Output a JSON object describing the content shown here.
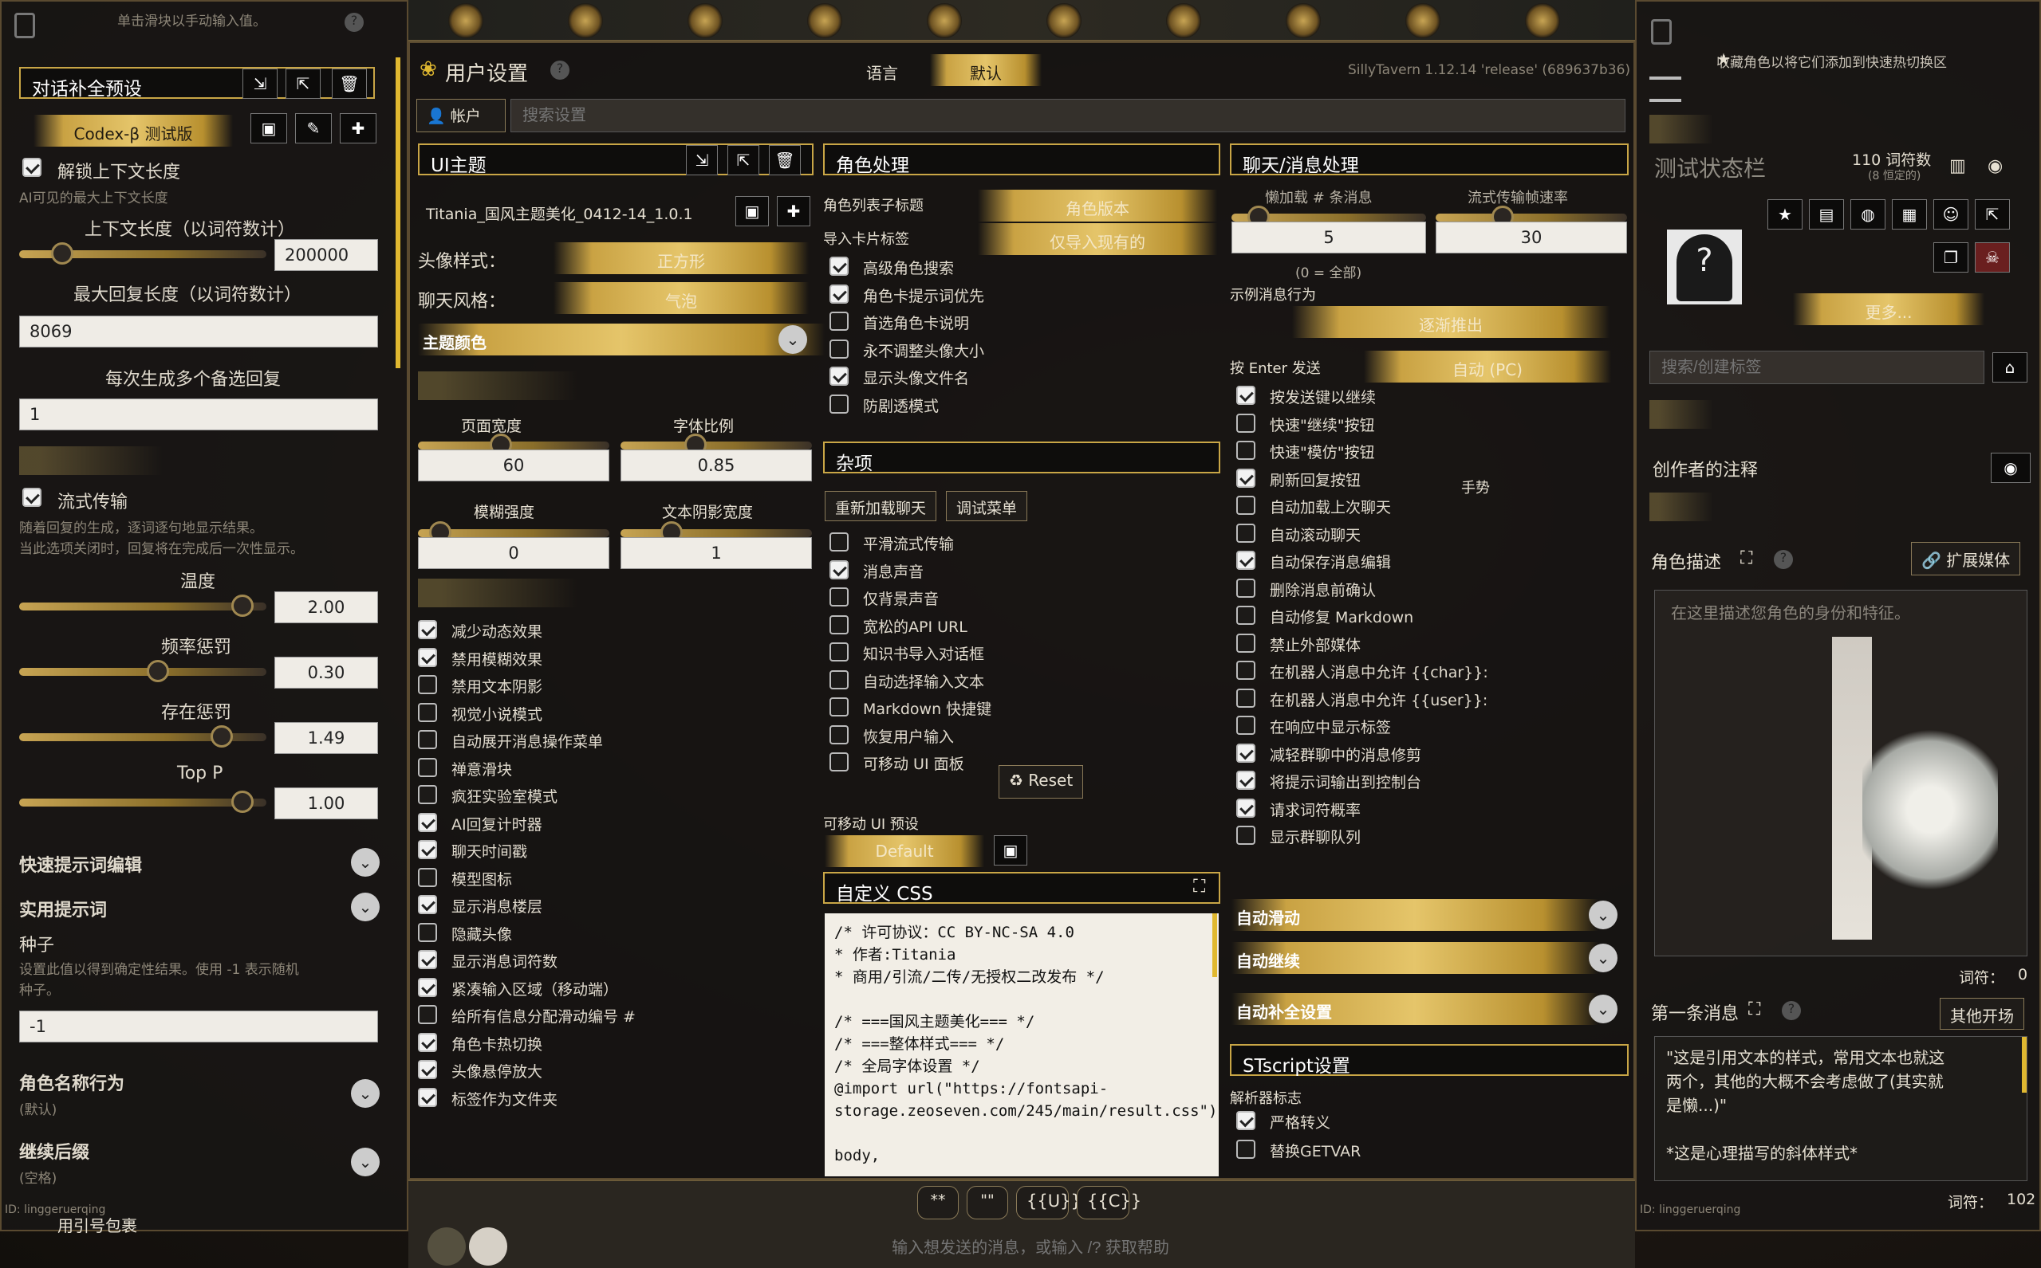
{
  "left": {
    "hint": "单击滑块以手动输入值。",
    "preset_header": "对话补全预设",
    "preset_name": "Codex-β 测试版",
    "unlock_ctx": "解锁上下文长度",
    "unlock_desc": "AI可见的最大上下文长度",
    "ctx_label": "上下文长度（以词符数计）",
    "ctx_value": "200000",
    "resp_label": "最大回复长度（以词符数计）",
    "resp_value": "8069",
    "n_label": "每次生成多个备选回复",
    "n_value": "1",
    "stream_label": "流式传输",
    "stream_desc1": "随着回复的生成，逐词逐句地显示结果。",
    "stream_desc2": "当此选项关闭时，回复将在完成后一次性显示。",
    "temp_label": "温度",
    "temp_value": "2.00",
    "freq_label": "频率惩罚",
    "freq_value": "0.30",
    "pres_label": "存在惩罚",
    "pres_value": "1.49",
    "topp_label": "Top P",
    "topp_value": "1.00",
    "quick_edit": "快速提示词编辑",
    "utility": "实用提示词",
    "seed_label": "种子",
    "seed_desc1": "设置此值以得到确定性结果。使用 -1 表示随机",
    "seed_desc2": "种子。",
    "seed_value": "-1",
    "name_behavior": "角色名称行为",
    "name_default": "(默认)",
    "continue_postfix": "继续后缀",
    "continue_value": "(空格)",
    "id_text": "ID: linggeruerqing",
    "cut_text": "用引号包裹"
  },
  "center": {
    "title": "用户设置",
    "lang_label": "语言",
    "lang_value": "默认",
    "version": "SillyTavern 1.12.14 'release' (689637b36)",
    "account": "帐户",
    "search_placeholder": "搜索设置",
    "ui_theme": "UI主题",
    "theme_name": "Titania_国风主题美化_0412-14_1.0.1",
    "avatar_style_label": "头像样式：",
    "avatar_style_value": "正方形",
    "chat_style_label": "聊天风格：",
    "chat_style_value": "气泡",
    "theme_color": "主题颜色",
    "page_width": "页面宽度",
    "font_scale": "字体比例",
    "page_width_value": "60",
    "font_scale_value": "0.85",
    "blur": "模糊强度",
    "shadow": "文本阴影宽度",
    "blur_value": "0",
    "shadow_value": "1",
    "ui_checks": [
      {
        "label": "减少动态效果",
        "on": true
      },
      {
        "label": "禁用模糊效果",
        "on": true
      },
      {
        "label": "禁用文本阴影",
        "on": false
      },
      {
        "label": "视觉小说模式",
        "on": false
      },
      {
        "label": "自动展开消息操作菜单",
        "on": false
      },
      {
        "label": "禅意滑块",
        "on": false
      },
      {
        "label": "疯狂实验室模式",
        "on": false
      },
      {
        "label": "AI回复计时器",
        "on": true
      },
      {
        "label": "聊天时间戳",
        "on": true
      },
      {
        "label": "模型图标",
        "on": false
      },
      {
        "label": "显示消息楼层",
        "on": true
      },
      {
        "label": "隐藏头像",
        "on": false
      },
      {
        "label": "显示消息词符数",
        "on": true
      },
      {
        "label": "紧凑输入区域（移动端）",
        "on": true
      },
      {
        "label": "给所有信息分配滑动编号 #",
        "on": false
      },
      {
        "label": "角色卡热切换",
        "on": true
      },
      {
        "label": "头像悬停放大",
        "on": true
      },
      {
        "label": "标签作为文件夹",
        "on": true
      }
    ],
    "char_header": "角色处理",
    "char_list_label": "角色列表子标题",
    "char_list_value": "角色版本",
    "import_tags_label": "导入卡片标签",
    "import_tags_value": "仅导入现有的",
    "char_checks": [
      {
        "label": "高级角色搜索",
        "on": true
      },
      {
        "label": "角色卡提示词优先",
        "on": true
      },
      {
        "label": "首选角色卡说明",
        "on": false
      },
      {
        "label": "永不调整头像大小",
        "on": false
      },
      {
        "label": "显示头像文件名",
        "on": true
      },
      {
        "label": "防剧透模式",
        "on": false
      }
    ],
    "misc_header": "杂项",
    "reload_chat": "重新加载聊天",
    "debug_menu": "调试菜单",
    "misc_checks": [
      {
        "label": "平滑流式传输",
        "on": false
      },
      {
        "label": "消息声音",
        "on": true
      },
      {
        "label": "仅背景声音",
        "on": false
      },
      {
        "label": "宽松的API URL",
        "on": false
      },
      {
        "label": "知识书导入对话框",
        "on": false
      },
      {
        "label": "自动选择输入文本",
        "on": false
      },
      {
        "label": "Markdown 快捷键",
        "on": false
      },
      {
        "label": "恢复用户输入",
        "on": false
      },
      {
        "label": "可移动 UI 面板",
        "on": false
      }
    ],
    "reset": "Reset",
    "movable_preset": "可移动 UI 预设",
    "movable_value": "Default",
    "custom_css": "自定义 CSS",
    "css_text": "/* 许可协议：CC BY-NC-SA 4.0\n* 作者:Titania\n* 商用/引流/二传/无授权二改发布 */\n\n/* ===国风主题美化=== */\n/* ===整体样式=== */\n/* 全局字体设置 */\n@import url(\"https://fontsapi-\nstorage.zeoseven.com/245/main/result.css\");\n\nbody,",
    "chat_header": "聊天/消息处理",
    "lazy_label": "懒加载 # 条消息",
    "stream_fps": "流式传输帧速率",
    "lazy_value": "5",
    "fps_value": "30",
    "zero_all": "(0 = 全部)",
    "example_label": "示例消息行为",
    "example_value": "逐渐推出",
    "enter_label": "按 Enter 发送",
    "enter_value": "自动 (PC)",
    "chat_checks": [
      {
        "label": "按发送键以继续",
        "on": true
      },
      {
        "label": "快速\"继续\"按钮",
        "on": false
      },
      {
        "label": "快速\"模仿\"按钮",
        "on": false
      },
      {
        "label": "刷新回复按钮",
        "on": true
      },
      {
        "label": "自动加载上次聊天",
        "on": false
      },
      {
        "label": "自动滚动聊天",
        "on": false
      },
      {
        "label": "自动保存消息编辑",
        "on": true
      },
      {
        "label": "删除消息前确认",
        "on": false
      },
      {
        "label": "自动修复 Markdown",
        "on": false
      },
      {
        "label": "禁止外部媒体",
        "on": false
      },
      {
        "label": "在机器人消息中允许 {{char}}:",
        "on": false
      },
      {
        "label": "在机器人消息中允许 {{user}}:",
        "on": false
      },
      {
        "label": "在响应中显示标签",
        "on": false
      },
      {
        "label": "减轻群聊中的消息修剪",
        "on": true
      },
      {
        "label": "将提示词输出到控制台",
        "on": true
      },
      {
        "label": "请求词符概率",
        "on": true
      },
      {
        "label": "显示群聊队列",
        "on": false
      }
    ],
    "gesture": "手势",
    "auto_scroll": "自动滑动",
    "auto_continue": "自动继续",
    "auto_complete": "自动补全设置",
    "stscript": "STscript设置",
    "parser_flags": "解析器标志",
    "strict_escape": "严格转义",
    "replace_getvar": "替换GETVAR"
  },
  "bottom": {
    "btn1": "**",
    "btn2": "\"\"",
    "btn3": "{{U}}",
    "btn4": "{{C}}",
    "input_placeholder": "输入想发送的消息，或输入 /? 获取帮助"
  },
  "right": {
    "fav_hint": "收藏角色以将它们添加到快速热切换区",
    "char_name": "测试状态栏",
    "token_count": "110 词符数",
    "token_perm": "(8 恒定的)",
    "more": "更多...",
    "tag_placeholder": "搜索/创建标签",
    "creator_notes": "创作者的注释",
    "char_desc": "角色描述",
    "expand_media": "扩展媒体",
    "desc_placeholder": "在这里描述您角色的身份和特征。",
    "tokens_label": "词符：",
    "desc_tokens": "0",
    "first_msg": "第一条消息",
    "alt_greet": "其他开场",
    "first_text1": "\"这是引用文本的样式，常用文本也就这",
    "first_text2": "两个，其他的大概不会考虑做了(其实就",
    "first_text3": "是懒...)\"",
    "first_text4": "*这是心理描写的斜体样式*",
    "first_tokens": "102",
    "id_text": "ID: linggeruerqing"
  },
  "colors": {
    "gold": "#c9a646",
    "panel": "#181614",
    "text": "#e6e0d2"
  }
}
